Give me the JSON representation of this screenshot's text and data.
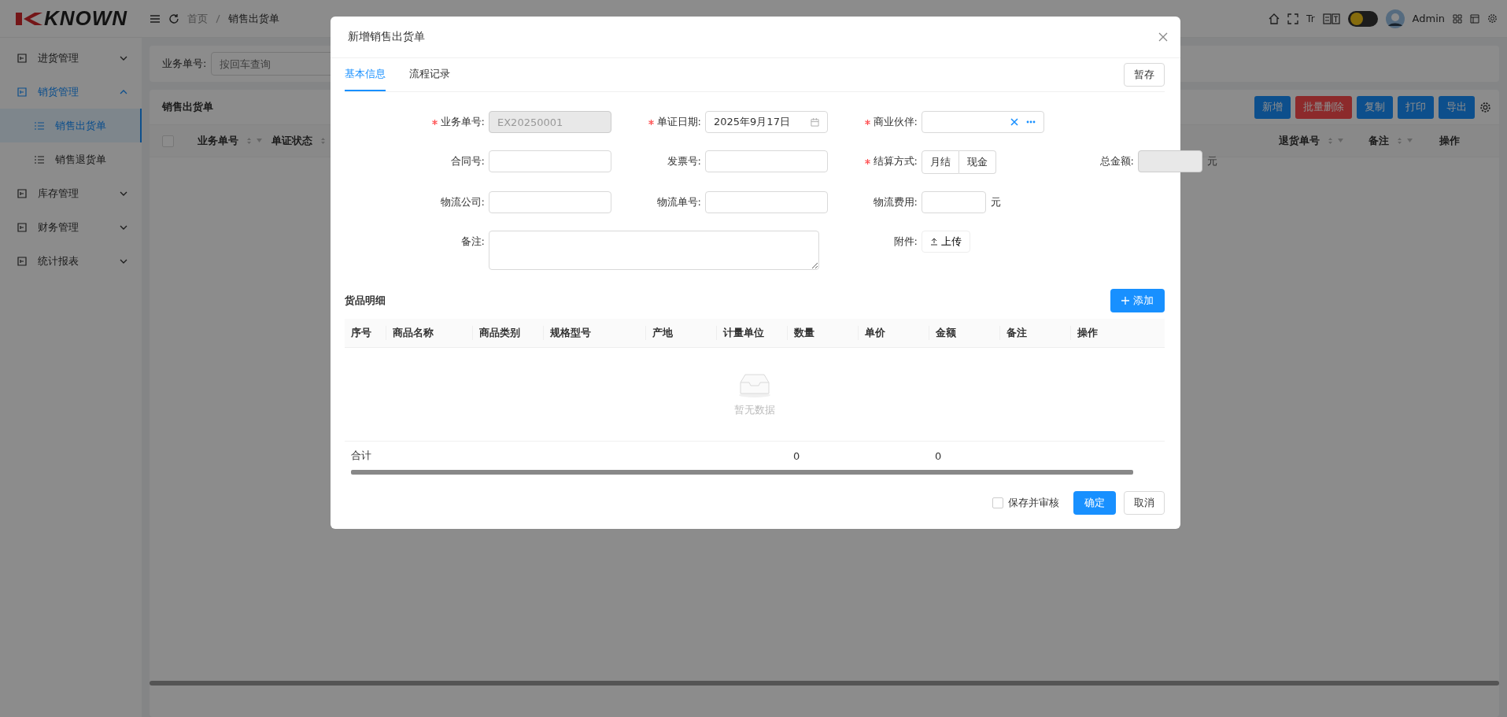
{
  "header": {
    "logo": "KNOWN",
    "breadcrumb": [
      "首页",
      "销售出货单"
    ],
    "font_tool": "Tr",
    "dark_mode": {
      "on": false
    },
    "user": "Admin"
  },
  "sidebar": {
    "items": [
      {
        "label": "进货管理",
        "expanded": false
      },
      {
        "label": "销货管理",
        "expanded": true,
        "children": [
          {
            "label": "销售出货单",
            "selected": true
          },
          {
            "label": "销售退货单",
            "selected": false
          }
        ]
      },
      {
        "label": "库存管理",
        "expanded": false
      },
      {
        "label": "财务管理",
        "expanded": false
      },
      {
        "label": "统计报表",
        "expanded": false
      }
    ]
  },
  "search": {
    "label": "业务单号:",
    "placeholder": "按回车查询"
  },
  "list": {
    "title": "销售出货单",
    "toolbar": [
      {
        "label": "新增",
        "kind": "add"
      },
      {
        "label": "批量删除",
        "kind": "delete"
      },
      {
        "label": "复制",
        "kind": "copy"
      },
      {
        "label": "打印",
        "kind": "print"
      },
      {
        "label": "导出",
        "kind": "export"
      }
    ],
    "select_all": {
      "checked": false
    },
    "columns_left": [
      {
        "label": "业务单号",
        "sortable": true
      },
      {
        "label": "单证状态",
        "sortable": true
      }
    ],
    "columns_right": [
      {
        "label": "退货单号",
        "sortable": true
      },
      {
        "label": "备注",
        "sortable": true
      },
      {
        "label": "操作",
        "sortable": false
      }
    ]
  },
  "dialog": {
    "title": "新增销售出货单",
    "tabs": [
      {
        "label": "基本信息",
        "selected": true
      },
      {
        "label": "流程记录",
        "selected": false
      }
    ],
    "draft_button": "暂存",
    "fields": [
      {
        "label": "业务单号:",
        "required": true,
        "kind": "text",
        "value": "EX20250001",
        "disabled": true
      },
      {
        "label": "单证日期:",
        "required": true,
        "kind": "date",
        "value": "2025年9月17日",
        "disabled": false
      },
      {
        "label": "商业伙伴:",
        "required": true,
        "kind": "picker",
        "disabled": false
      },
      {
        "kind": "empty"
      },
      {
        "label": "合同号:",
        "required": false,
        "kind": "text",
        "disabled": false
      },
      {
        "label": "发票号:",
        "required": false,
        "kind": "text",
        "disabled": false
      },
      {
        "label": "结算方式:",
        "required": true,
        "kind": "segmented",
        "options": [
          {
            "label": "月结",
            "selected": false
          },
          {
            "label": "现金",
            "selected": false
          }
        ]
      },
      {
        "label": "总金额:",
        "required": false,
        "kind": "amount",
        "unit": "元",
        "disabled": true
      },
      {
        "label": "物流公司:",
        "required": false,
        "kind": "text",
        "disabled": false
      },
      {
        "label": "物流单号:",
        "required": false,
        "kind": "text",
        "disabled": false
      },
      {
        "label": "物流费用:",
        "required": false,
        "kind": "amount",
        "unit": "元",
        "disabled": false
      },
      {
        "kind": "empty"
      },
      {
        "label": "备注:",
        "required": false,
        "kind": "textarea"
      },
      {
        "label": "附件:",
        "required": false,
        "kind": "upload",
        "button": "上传"
      }
    ],
    "goods": {
      "title": "货品明细",
      "add_button": "添加",
      "columns": [
        {
          "label": "序号"
        },
        {
          "label": "商品名称"
        },
        {
          "label": "商品类别"
        },
        {
          "label": "规格型号"
        },
        {
          "label": "产地"
        },
        {
          "label": "计量单位"
        },
        {
          "label": "数量",
          "total": "0"
        },
        {
          "label": "单价"
        },
        {
          "label": "金额",
          "total": "0"
        },
        {
          "label": "备注"
        },
        {
          "label": "操作"
        }
      ],
      "empty_text": "暂无数据",
      "total_label": "合计"
    },
    "save_and_review": {
      "label": "保存并审核",
      "checked": false
    },
    "ok_button": "确定",
    "cancel_button": "取消"
  }
}
